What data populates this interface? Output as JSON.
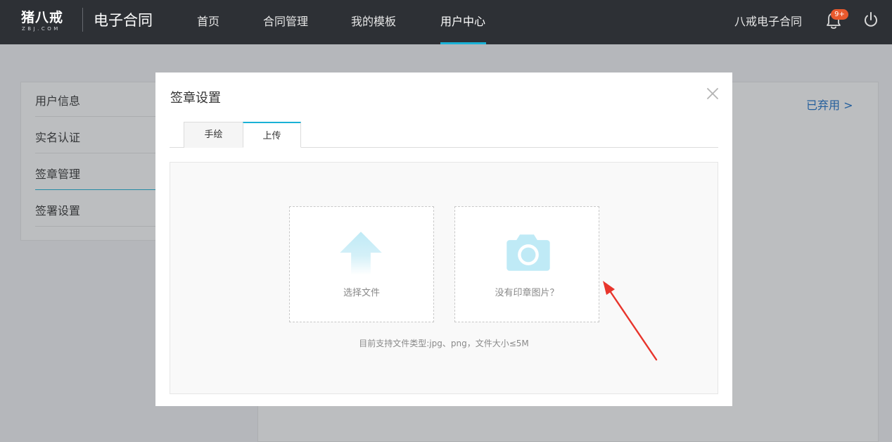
{
  "nav": {
    "logo_text": "猪八戒",
    "logo_sub": "ZBJ.COM",
    "product_title": "电子合同",
    "items": [
      {
        "label": "首页"
      },
      {
        "label": "合同管理"
      },
      {
        "label": "我的模板"
      },
      {
        "label": "用户中心"
      }
    ],
    "active_item": "用户中心",
    "brand_link": "八戒电子合同",
    "notification_badge": "9+",
    "icons": [
      "bell-icon",
      "power-icon"
    ],
    "accent_color": "#1ab1d6",
    "badge_color": "#e8592d"
  },
  "sidebar": {
    "items": [
      {
        "label": "用户信息"
      },
      {
        "label": "实名认证"
      },
      {
        "label": "签章管理"
      },
      {
        "label": "签署设置"
      }
    ],
    "active_item": "签章管理"
  },
  "content": {
    "abandoned_link": "已弃用 >"
  },
  "modal": {
    "title": "签章设置",
    "close_icon": "close-icon",
    "tabs": [
      {
        "label": "手绘"
      },
      {
        "label": "上传"
      }
    ],
    "active_tab": "上传",
    "upload": {
      "select_file_label": "选择文件",
      "no_seal_label": "没有印章图片？",
      "hint": "目前支持文件类型:jpg、png，文件大小≤5M",
      "icons": [
        "upload-arrow-icon",
        "camera-icon"
      ],
      "icon_color": "#bfeaf6"
    }
  },
  "annotation": {
    "arrow_color": "#e8352c"
  }
}
